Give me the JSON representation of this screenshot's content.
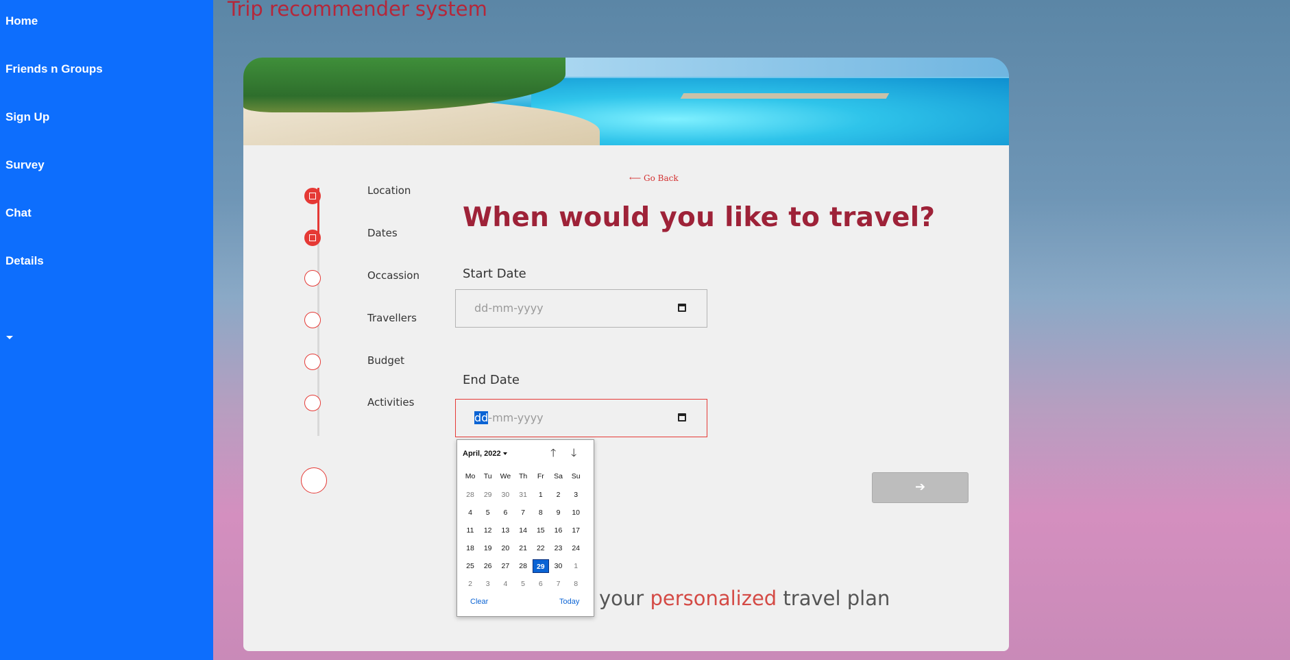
{
  "site_title": "Trip recommender system",
  "sidebar": {
    "items": [
      {
        "label": "Home"
      },
      {
        "label": "Friends n Groups"
      },
      {
        "label": "Sign Up"
      },
      {
        "label": "Survey"
      },
      {
        "label": "Chat"
      },
      {
        "label": "Details"
      }
    ]
  },
  "stepper": {
    "steps": [
      {
        "label": "Location",
        "status": "done"
      },
      {
        "label": "Dates",
        "status": "done"
      },
      {
        "label": "Occassion",
        "status": "pending"
      },
      {
        "label": "Travellers",
        "status": "pending"
      },
      {
        "label": "Budget",
        "status": "pending"
      },
      {
        "label": "Activities",
        "status": "pending"
      }
    ]
  },
  "go_back": "⟵ Go Back",
  "question": "When would you like to travel?",
  "start_date": {
    "label": "Start Date",
    "placeholder": "dd-mm-yyyy"
  },
  "end_date": {
    "label": "End Date",
    "placeholder_selected": "dd",
    "placeholder_rest": "-mm-yyyy"
  },
  "next_button": {
    "icon": "arrow-right-icon",
    "symbol": "➔"
  },
  "tagline": {
    "pre": "your ",
    "highlight": "personalized",
    "post": " travel plan"
  },
  "calendar": {
    "month_label": "April, 2022",
    "weekdays": [
      "Mo",
      "Tu",
      "We",
      "Th",
      "Fr",
      "Sa",
      "Su"
    ],
    "weeks": [
      [
        "28",
        "29",
        "30",
        "31",
        "1",
        "2",
        "3"
      ],
      [
        "4",
        "5",
        "6",
        "7",
        "8",
        "9",
        "10"
      ],
      [
        "11",
        "12",
        "13",
        "14",
        "15",
        "16",
        "17"
      ],
      [
        "18",
        "19",
        "20",
        "21",
        "22",
        "23",
        "24"
      ],
      [
        "25",
        "26",
        "27",
        "28",
        "29",
        "30",
        "1"
      ],
      [
        "2",
        "3",
        "4",
        "5",
        "6",
        "7",
        "8"
      ]
    ],
    "selected_day": "29",
    "clear_label": "Clear",
    "today_label": "Today",
    "up_arrow": "🡑",
    "down_arrow": "🡓"
  },
  "colors": {
    "sidebar": "#0d6efd",
    "accent_red": "#e53935",
    "title_red": "#9e2238",
    "selected_blue": "#0a63d4"
  }
}
